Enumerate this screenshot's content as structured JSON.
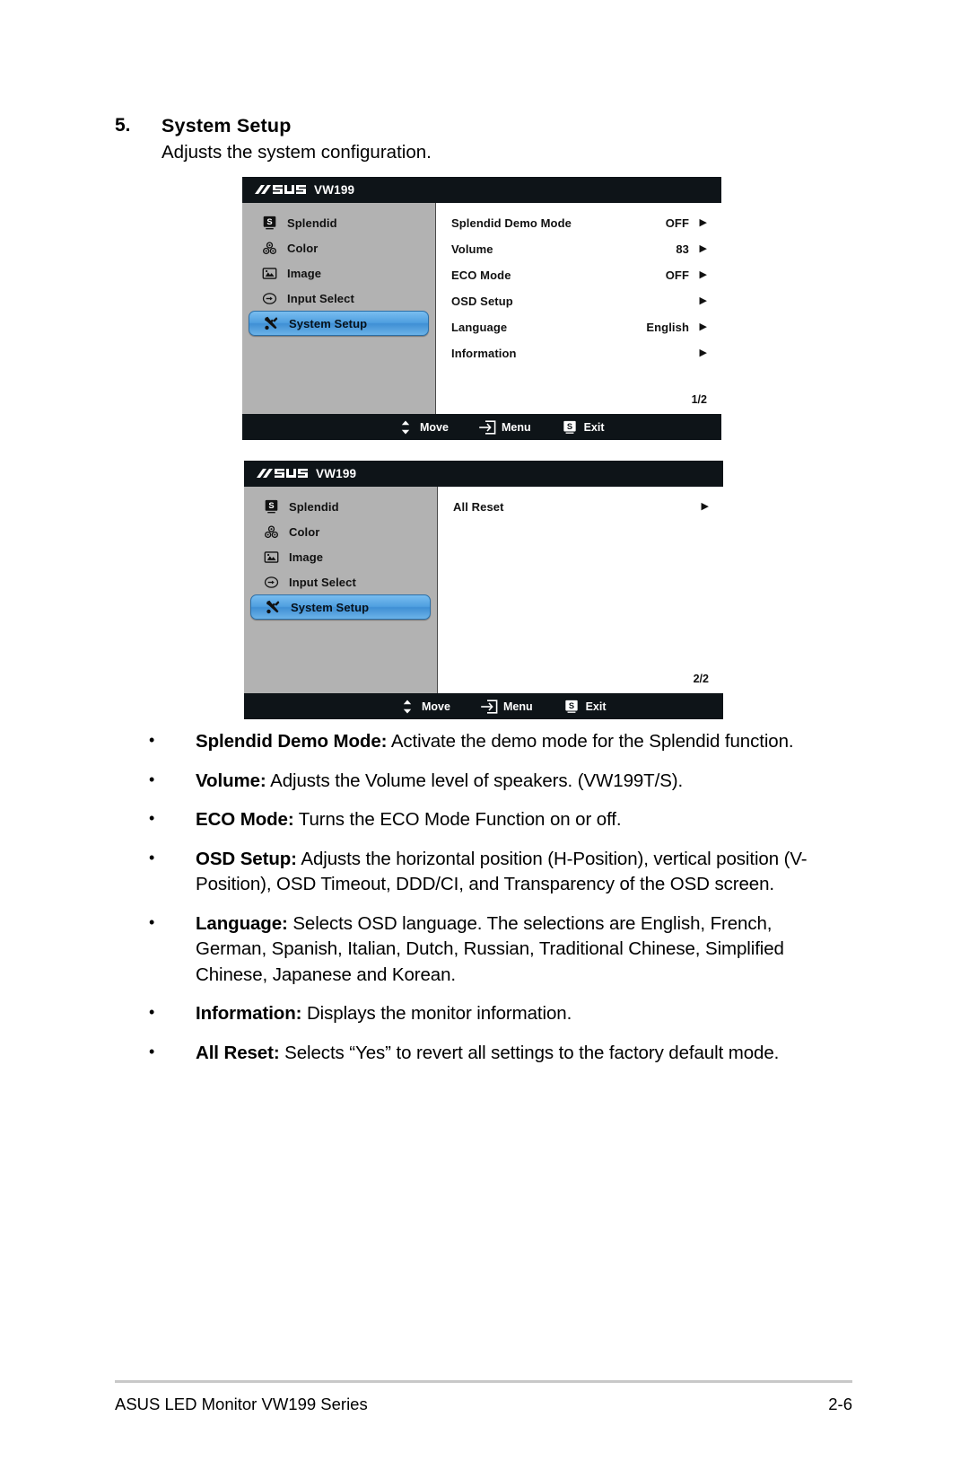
{
  "heading": {
    "number": "5.",
    "title": "System Setup",
    "subtitle": "Adjusts the system configuration."
  },
  "osd_menus": [
    {
      "name": "system-setup-page-1",
      "titlebar": {
        "logo": "asus-logo",
        "model": "VW199"
      },
      "sidebar": [
        {
          "icon": "splendid-icon",
          "label": "Splendid",
          "selected": false
        },
        {
          "icon": "color-icon",
          "label": "Color",
          "selected": false
        },
        {
          "icon": "image-icon",
          "label": "Image",
          "selected": false
        },
        {
          "icon": "input-select-icon",
          "label": "Input Select",
          "selected": false
        },
        {
          "icon": "system-setup-icon",
          "label": "System Setup",
          "selected": true
        }
      ],
      "options": [
        {
          "label": "Splendid Demo Mode",
          "value": "OFF",
          "arrow": "▶"
        },
        {
          "label": "Volume",
          "value": "83",
          "arrow": "▶"
        },
        {
          "label": "ECO Mode",
          "value": "OFF",
          "arrow": "▶"
        },
        {
          "label": "OSD Setup",
          "value": "",
          "arrow": "▶"
        },
        {
          "label": "Language",
          "value": "English",
          "arrow": "▶"
        },
        {
          "label": "Information",
          "value": "",
          "arrow": "▶"
        }
      ],
      "page_indicator": "1/2",
      "footer": [
        {
          "icon": "move-updown-icon",
          "label": "Move"
        },
        {
          "icon": "menu-enter-icon",
          "label": "Menu"
        },
        {
          "icon": "splendid-s-icon",
          "label": "Exit"
        }
      ]
    },
    {
      "name": "system-setup-page-2",
      "titlebar": {
        "logo": "asus-logo",
        "model": "VW199"
      },
      "sidebar": [
        {
          "icon": "splendid-icon",
          "label": "Splendid",
          "selected": false
        },
        {
          "icon": "color-icon",
          "label": "Color",
          "selected": false
        },
        {
          "icon": "image-icon",
          "label": "Image",
          "selected": false
        },
        {
          "icon": "input-select-icon",
          "label": "Input Select",
          "selected": false
        },
        {
          "icon": "system-setup-icon",
          "label": "System Setup",
          "selected": true
        }
      ],
      "options": [
        {
          "label": "All Reset",
          "value": "",
          "arrow": "▶"
        }
      ],
      "page_indicator": "2/2",
      "footer": [
        {
          "icon": "move-updown-icon",
          "label": "Move"
        },
        {
          "icon": "menu-enter-icon",
          "label": "Menu"
        },
        {
          "icon": "splendid-s-icon",
          "label": "Exit"
        }
      ]
    }
  ],
  "bullets": [
    {
      "term": "Splendid Demo Mode:",
      "text": " Activate the demo mode for the Splendid function."
    },
    {
      "term": "Volume:",
      "text": " Adjusts the Volume level of speakers. (VW199T/S)."
    },
    {
      "term": "ECO Mode:",
      "text": " Turns the ECO Mode Function on or off."
    },
    {
      "term": "OSD Setup:",
      "text": " Adjusts the horizontal position (H-Position), vertical position (V-Position), OSD Timeout, DDD/CI, and Transparency of the OSD screen."
    },
    {
      "term": "Language:",
      "text": " Selects OSD language. The selections are English, French, German, Spanish, Italian, Dutch, Russian, Traditional Chinese, Simplified Chinese, Japanese and Korean."
    },
    {
      "term": "Information:",
      "text": " Displays the monitor information."
    },
    {
      "term": "All Reset:",
      "text": " Selects “Yes” to revert all settings to the factory default mode."
    }
  ],
  "footer": {
    "left": "ASUS LED Monitor VW199 Series",
    "right": "2-6"
  },
  "colors": {
    "osd_titlebar": "#0e1418",
    "osd_sidebar": "#b2b2b2",
    "osd_highlight": "#4f9fe0",
    "footer_rule": "#c8c8c8"
  }
}
